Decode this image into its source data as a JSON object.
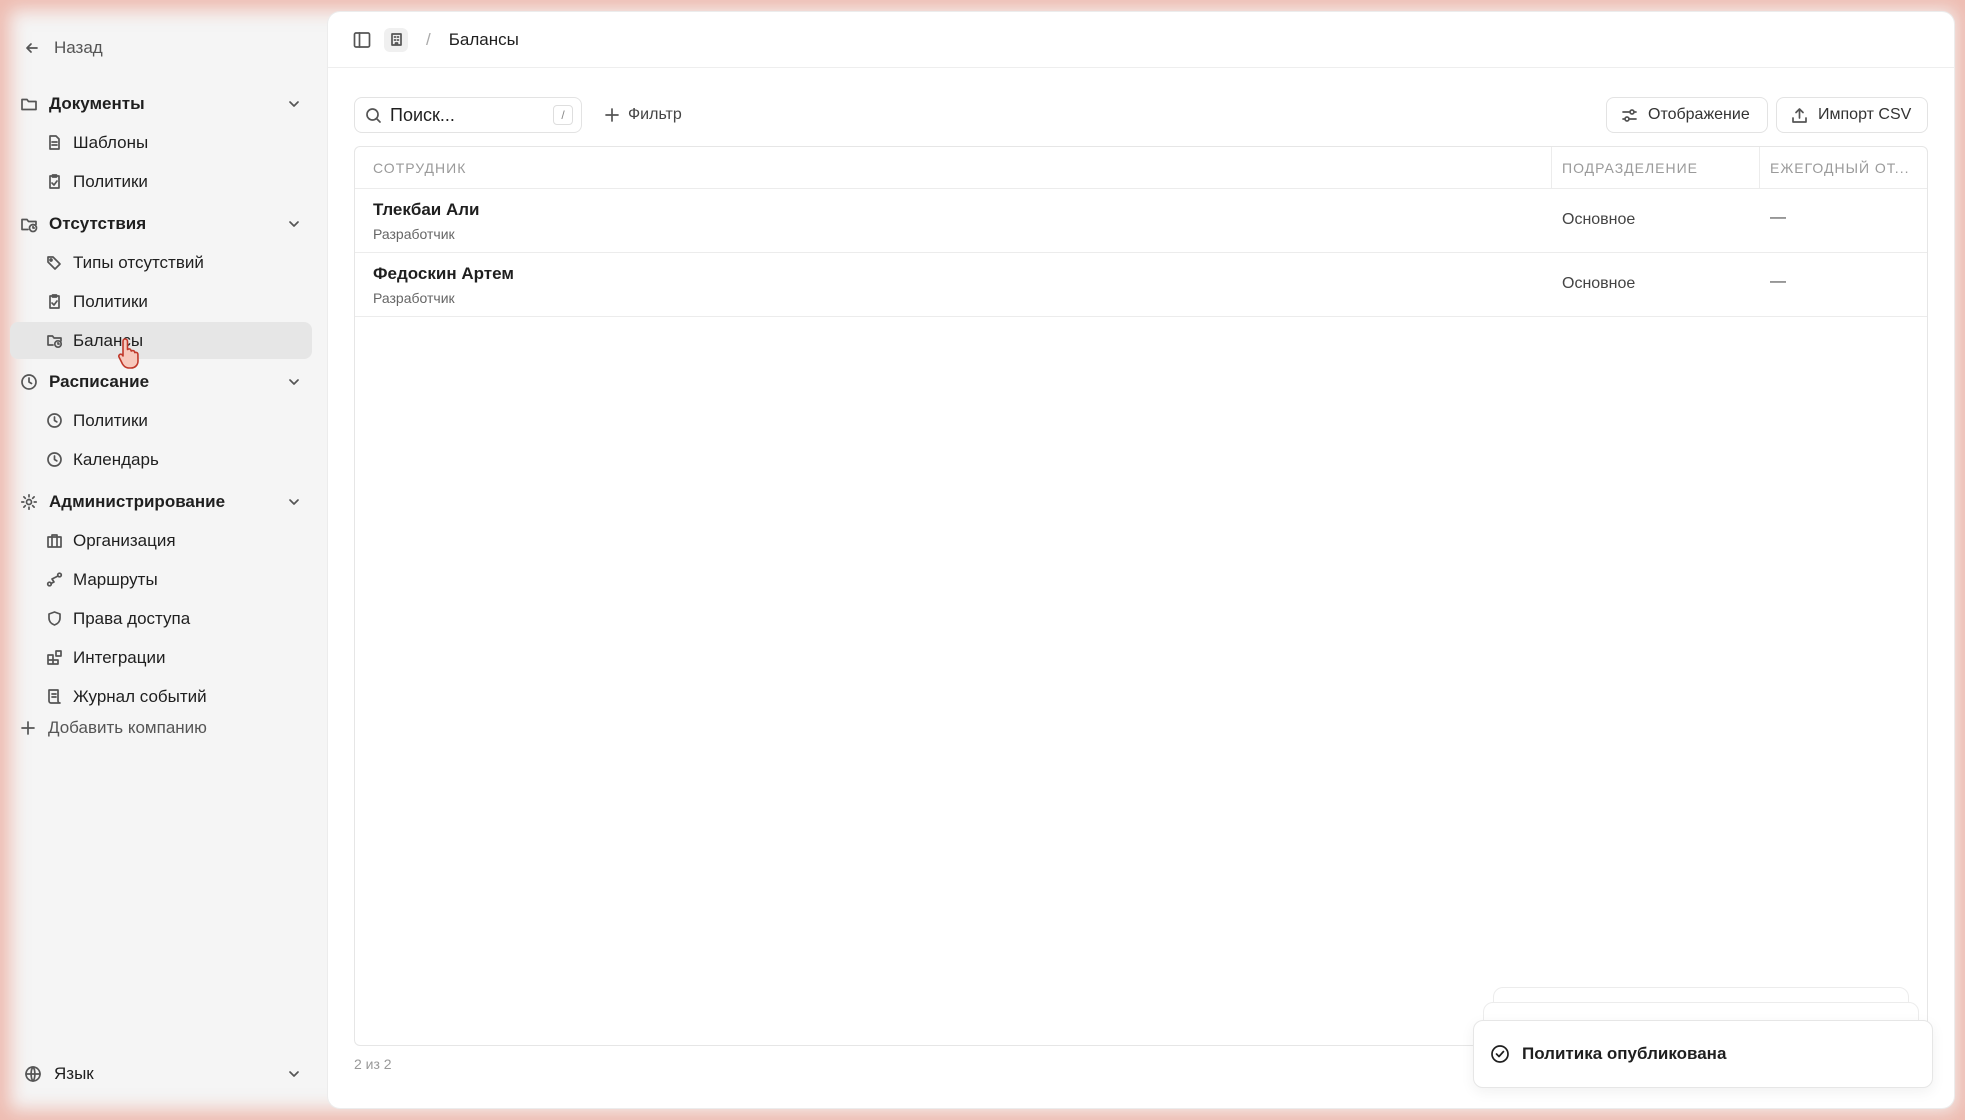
{
  "sidebar": {
    "back_label": "Назад",
    "groups": [
      {
        "label": "Документы",
        "items": [
          {
            "label": "Шаблоны"
          },
          {
            "label": "Политики"
          }
        ]
      },
      {
        "label": "Отсутствия",
        "items": [
          {
            "label": "Типы отсутствий"
          },
          {
            "label": "Политики"
          },
          {
            "label": "Балансы"
          }
        ]
      },
      {
        "label": "Расписание",
        "items": [
          {
            "label": "Политики"
          },
          {
            "label": "Календарь"
          }
        ]
      },
      {
        "label": "Администрирование",
        "items": [
          {
            "label": "Организация"
          },
          {
            "label": "Маршруты"
          },
          {
            "label": "Права доступа"
          },
          {
            "label": "Интеграции"
          },
          {
            "label": "Журнал событий"
          }
        ]
      }
    ],
    "add_company_label": "Добавить компанию",
    "language_label": "Язык"
  },
  "header": {
    "breadcrumb_separator": "/",
    "title": "Балансы"
  },
  "toolbar": {
    "search_placeholder": "Поиск...",
    "search_shortcut": "/",
    "filter_label": "Фильтр",
    "display_label": "Отображение",
    "import_label": "Импорт CSV"
  },
  "table": {
    "columns": [
      "СОТРУДНИК",
      "ПОДРАЗДЕЛЕНИЕ",
      "ЕЖЕГОДНЫЙ ОТ..."
    ],
    "rows": [
      {
        "name": "Тлекбаи Али",
        "role": "Разработчик",
        "department": "Основное",
        "annual": "—"
      },
      {
        "name": "Федоскин Артем",
        "role": "Разработчик",
        "department": "Основное",
        "annual": "—"
      }
    ],
    "count_label": "2 из 2"
  },
  "toast": {
    "message": "Политика опубликована"
  }
}
